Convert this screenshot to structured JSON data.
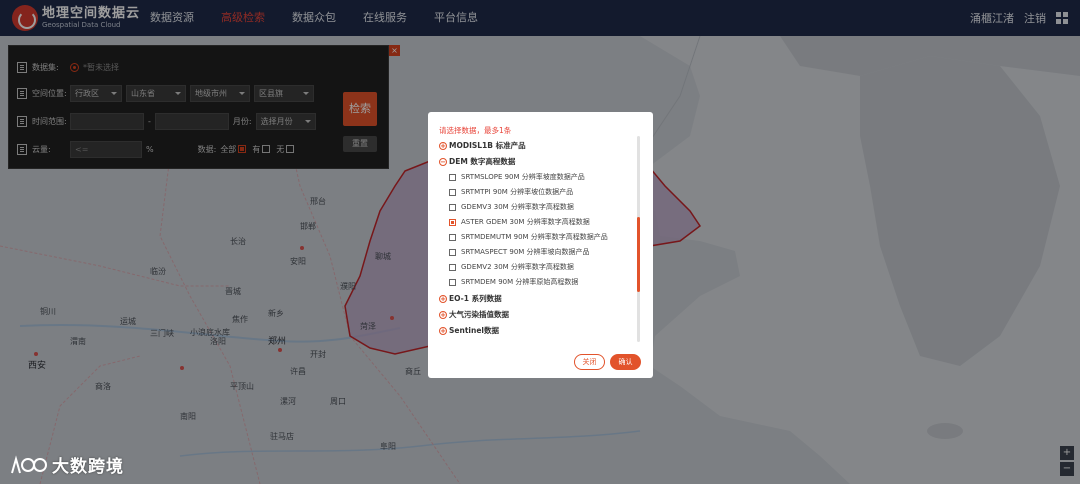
{
  "header": {
    "logo_cn": "地理空间数据云",
    "logo_en": "Geospatial Data Cloud",
    "nav": [
      {
        "label": "数据资源",
        "active": false
      },
      {
        "label": "高级检索",
        "active": true
      },
      {
        "label": "数据众包",
        "active": false
      },
      {
        "label": "在线服务",
        "active": false
      },
      {
        "label": "平台信息",
        "active": false
      }
    ],
    "user": "涌櫃江渚",
    "logout": "注销"
  },
  "search_panel": {
    "dataset_label": "数据集:",
    "dataset_hint": "*暂未选择",
    "location_label": "空间位置:",
    "location_type": "行政区",
    "province": "山东省",
    "city": "地级市州",
    "county": "区县旗",
    "time_label": "时间范围:",
    "time_sep": "-",
    "month_label": "月份:",
    "month_placeholder": "选择月份",
    "cloud_label": "云量:",
    "cloud_placeholder": "<=",
    "cloud_unit": "%",
    "data_label": "数据:",
    "opt_all": "全部",
    "opt_yes": "有",
    "opt_no": "无",
    "search_button": "检索",
    "reset_button": "重置",
    "close_icon": "×"
  },
  "map": {
    "labels": [
      {
        "text": "西安",
        "kind": "city"
      },
      {
        "text": "郑州",
        "kind": "city"
      },
      {
        "text": "开封",
        "kind": "town"
      },
      {
        "text": "洛阳",
        "kind": "town"
      },
      {
        "text": "三门峡",
        "kind": "town"
      },
      {
        "text": "商丘",
        "kind": "town"
      },
      {
        "text": "许昌",
        "kind": "town"
      },
      {
        "text": "平顶山",
        "kind": "town"
      },
      {
        "text": "漯河",
        "kind": "town"
      },
      {
        "text": "周口",
        "kind": "town"
      },
      {
        "text": "南阳",
        "kind": "town"
      },
      {
        "text": "驻马店",
        "kind": "town"
      },
      {
        "text": "焦作",
        "kind": "town"
      },
      {
        "text": "新乡",
        "kind": "town"
      },
      {
        "text": "渭南",
        "kind": "town"
      },
      {
        "text": "铜川",
        "kind": "town"
      },
      {
        "text": "运城",
        "kind": "town"
      },
      {
        "text": "临汾",
        "kind": "town"
      },
      {
        "text": "长治",
        "kind": "town"
      },
      {
        "text": "晋城",
        "kind": "town"
      },
      {
        "text": "安阳",
        "kind": "town"
      },
      {
        "text": "邯郸",
        "kind": "town"
      },
      {
        "text": "邢台",
        "kind": "town"
      },
      {
        "text": "濮阳",
        "kind": "town"
      },
      {
        "text": "聊城",
        "kind": "town"
      },
      {
        "text": "菏泽",
        "kind": "town"
      },
      {
        "text": "阜阳",
        "kind": "town"
      },
      {
        "text": "商洛",
        "kind": "town"
      },
      {
        "text": "小浪底水库",
        "kind": "town"
      }
    ],
    "zoom_in": "+",
    "zoom_out": "−"
  },
  "modal": {
    "tip": "请选择数据，最多1条",
    "categories": [
      {
        "toggle": "+",
        "label": "MODISL1B 标准产品"
      },
      {
        "toggle": "−",
        "label": "DEM 数字高程数据"
      },
      {
        "toggle": "+",
        "label": "EO-1 系列数据"
      },
      {
        "toggle": "+",
        "label": "大气污染插值数据"
      },
      {
        "toggle": "+",
        "label": "Sentinel数据"
      }
    ],
    "dem_items": [
      {
        "label": "SRTMSLOPE 90M 分辨率坡度数据产品",
        "checked": false
      },
      {
        "label": "SRTMTPI 90M 分辨率坡位数据产品",
        "checked": false
      },
      {
        "label": "GDEMV3 30M 分辨率数字高程数据",
        "checked": false
      },
      {
        "label": "ASTER GDEM 30M 分辨率数字高程数据",
        "checked": true
      },
      {
        "label": "SRTMDEMUTM 90M 分辨率数字高程数据产品",
        "checked": false
      },
      {
        "label": "SRTMASPECT 90M 分辨率坡向数据产品",
        "checked": false
      },
      {
        "label": "GDEMV2 30M 分辨率数字高程数据",
        "checked": false
      },
      {
        "label": "SRTMDEM 90M 分辨率原始高程数据",
        "checked": false
      }
    ],
    "close_button": "关闭",
    "ok_button": "确认"
  },
  "watermark": {
    "text": "大数跨境"
  },
  "colors": {
    "accent": "#e2532b",
    "nav_bg": "#1f2b4a",
    "highlight_region": "#b8a3c6"
  }
}
